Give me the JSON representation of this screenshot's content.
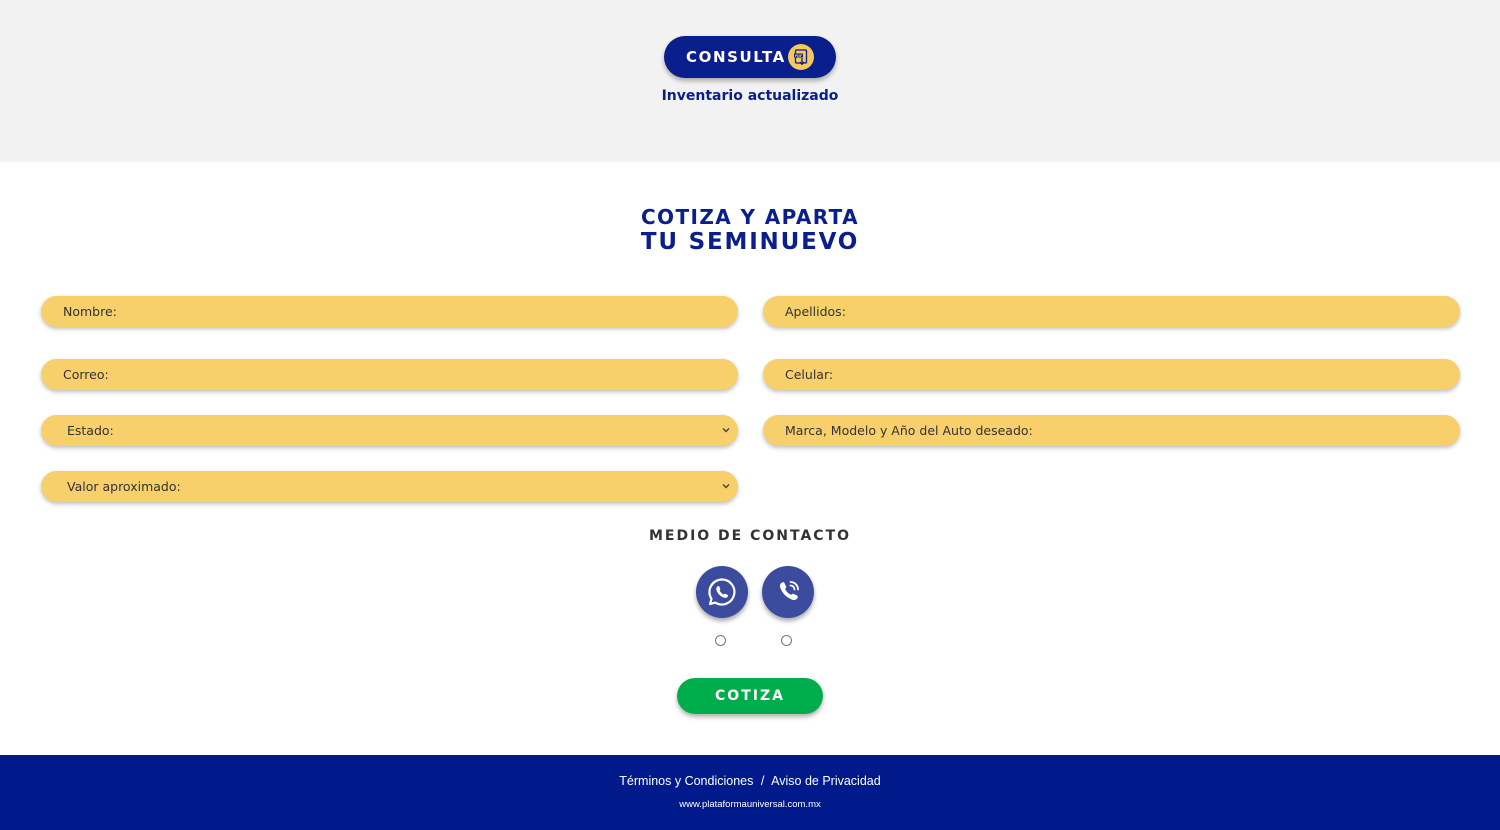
{
  "header": {
    "consulta_label": "CONSULTA",
    "inventario_text": "Inventario actualizado",
    "pdf_icon": "pdf-download-icon"
  },
  "form": {
    "title_line1": "COTIZA Y APARTA",
    "title_line2": "TU SEMINUEVO",
    "nombre_placeholder": "Nombre:",
    "apellidos_placeholder": "Apellidos:",
    "correo_placeholder": "Correo:",
    "celular_placeholder": "Celular:",
    "estado_value": "Estado:",
    "auto_placeholder": "Marca, Modelo y Año del Auto deseado:",
    "valor_value": "Valor aproximado:",
    "contact_title": "MEDIO DE CONTACTO",
    "contact_options": [
      {
        "icon": "whatsapp-icon"
      },
      {
        "icon": "phone-call-icon"
      }
    ],
    "submit_label": "COTIZA"
  },
  "footer": {
    "terminos": "Términos y Condiciones",
    "separator": "/",
    "aviso": "Aviso de Privacidad",
    "url": "www.plataformauniversal.com.mx"
  },
  "colors": {
    "brand_blue": "#0a1e8c",
    "field_yellow": "#f7d06b",
    "submit_green": "#00ad4c",
    "contact_circle": "#3b4b9e"
  }
}
